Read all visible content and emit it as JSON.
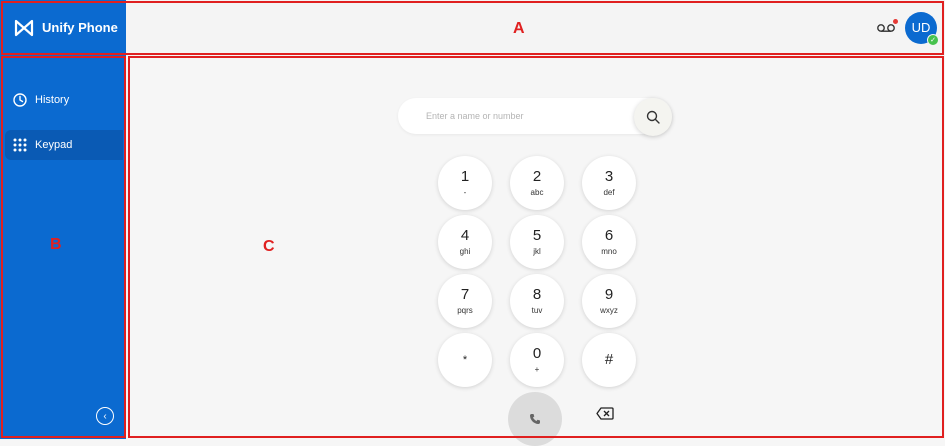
{
  "app": {
    "brand": "Unify Phone"
  },
  "header": {
    "voicemail_icon": "voicemail-icon",
    "avatar_initials": "UD",
    "presence": "available"
  },
  "sidebar": {
    "items": [
      {
        "label": "History",
        "icon": "clock-icon",
        "active": false
      },
      {
        "label": "Keypad",
        "icon": "dialpad-icon",
        "active": true
      }
    ],
    "collapse_icon": "chevron-left-icon"
  },
  "search": {
    "placeholder": "Enter a name or number",
    "value": ""
  },
  "keypad": {
    "keys": [
      {
        "digit": "1",
        "letters": "-"
      },
      {
        "digit": "2",
        "letters": "abc"
      },
      {
        "digit": "3",
        "letters": "def"
      },
      {
        "digit": "4",
        "letters": "ghi"
      },
      {
        "digit": "5",
        "letters": "jkl"
      },
      {
        "digit": "6",
        "letters": "mno"
      },
      {
        "digit": "7",
        "letters": "pqrs"
      },
      {
        "digit": "8",
        "letters": "tuv"
      },
      {
        "digit": "9",
        "letters": "wxyz"
      },
      {
        "digit": "*",
        "letters": ""
      },
      {
        "digit": "0",
        "letters": "+"
      },
      {
        "digit": "#",
        "letters": ""
      }
    ]
  },
  "annotations": {
    "a": "A",
    "b": "B",
    "c": "C"
  },
  "colors": {
    "brand": "#0b6ad0",
    "annotation": "#e02020",
    "presence": "#46c24d"
  }
}
